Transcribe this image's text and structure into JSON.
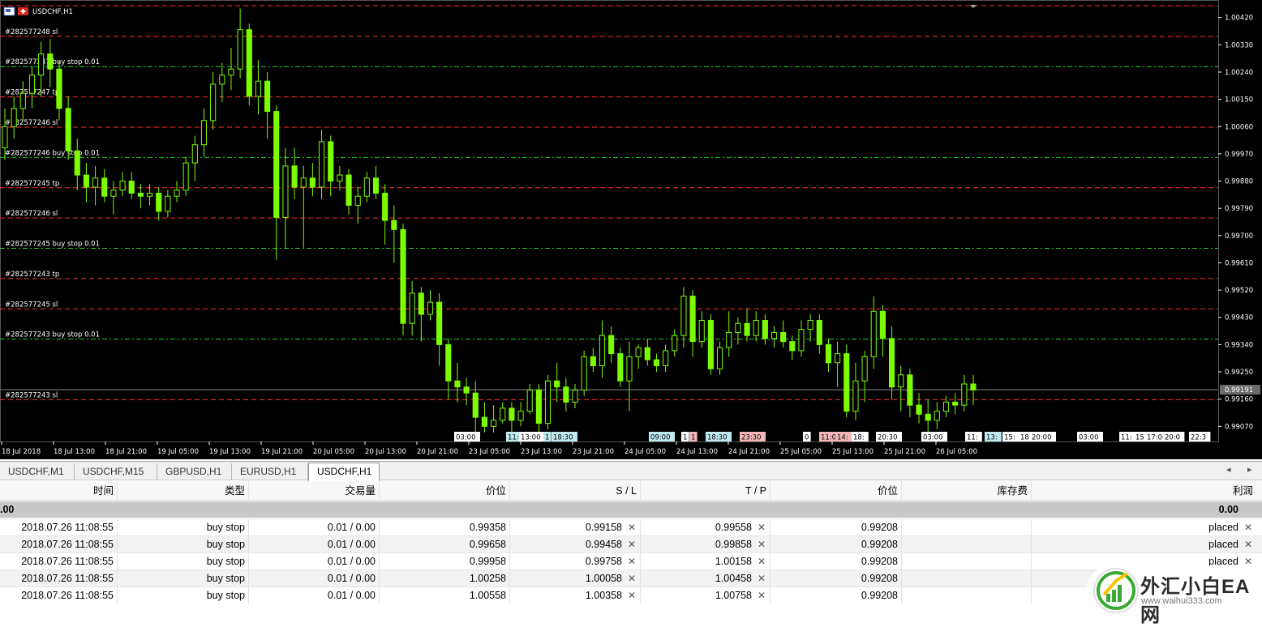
{
  "chart": {
    "title": "USDCHF,H1",
    "price_axis": [
      "1.00420",
      "1.00330",
      "1.00240",
      "1.00150",
      "1.00060",
      "0.99970",
      "0.99880",
      "0.99790",
      "0.99700",
      "0.99610",
      "0.99520",
      "0.99430",
      "0.99340",
      "0.99250",
      "0.99160",
      "0.99070"
    ],
    "current_price": "0.99191",
    "time_axis": [
      "18 Jul 2018",
      "18 Jul 13:00",
      "18 Jul 21:00",
      "19 Jul 05:00",
      "19 Jul 13:00",
      "19 Jul 21:00",
      "20 Jul 05:00",
      "20 Jul 13:00",
      "20 Jul 21:00",
      "23 Jul 05:00",
      "23 Jul 13:00",
      "23 Jul 21:00",
      "24 Jul 05:00",
      "24 Jul 13:00",
      "24 Jul 21:00",
      "25 Jul 05:00",
      "25 Jul 13:00",
      "25 Jul 21:00",
      "26 Jul 05:00"
    ],
    "order_lines": [
      {
        "label": "#282577248 sl",
        "type": "sl",
        "price": 1.00358
      },
      {
        "label": "#282577247 buy stop 0.01",
        "type": "entry",
        "price": 1.00258
      },
      {
        "label": "#282577247 tp",
        "type": "tp",
        "price": 1.00158
      },
      {
        "label": "#282577246 sl",
        "type": "sl",
        "price": 1.00058
      },
      {
        "label": "#282577246 buy stop 0.01",
        "type": "entry",
        "price": 0.99958
      },
      {
        "label": "#282577245 tp",
        "type": "tp",
        "price": 0.99858
      },
      {
        "label": "#282577246 sl",
        "type": "sl",
        "price": 0.99758
      },
      {
        "label": "#282577245 buy stop 0.01",
        "type": "entry",
        "price": 0.99658
      },
      {
        "label": "#282577243 tp",
        "type": "tp",
        "price": 0.99558
      },
      {
        "label": "#282577245 sl",
        "type": "sl",
        "price": 0.99458
      },
      {
        "label": "#282577243 buy stop 0.01",
        "type": "entry",
        "price": 0.99358
      },
      {
        "label": "#282577243 sl",
        "type": "sl",
        "price": 0.99158
      }
    ],
    "event_tags": [
      {
        "text": "03:00",
        "kind": "white"
      },
      {
        "text": "11:",
        "kind": "cyan"
      },
      {
        "text": "13:00",
        "kind": "white"
      },
      {
        "text": "1",
        "kind": "cyan"
      },
      {
        "text": "18:30",
        "kind": "cyan"
      },
      {
        "text": "09:00",
        "kind": "cyan"
      },
      {
        "text": "1",
        "kind": "white"
      },
      {
        "text": "1",
        "kind": "pink"
      },
      {
        "text": "18:30",
        "kind": "cyan"
      },
      {
        "text": "23:30",
        "kind": "pink"
      },
      {
        "text": "0",
        "kind": "white"
      },
      {
        "text": "11:00",
        "kind": "pink"
      },
      {
        "text": "14:",
        "kind": "pink"
      },
      {
        "text": "18:",
        "kind": "white"
      },
      {
        "text": "20:30",
        "kind": "white"
      },
      {
        "text": "03:00",
        "kind": "white"
      },
      {
        "text": "11:",
        "kind": "white"
      },
      {
        "text": "13:",
        "kind": "cyan"
      },
      {
        "text": "15:",
        "kind": "white"
      },
      {
        "text": "18:",
        "kind": "white"
      },
      {
        "text": "20:00",
        "kind": "white"
      },
      {
        "text": "03:00",
        "kind": "white"
      },
      {
        "text": "11:",
        "kind": "white"
      },
      {
        "text": "15",
        "kind": "white"
      },
      {
        "text": "17:00",
        "kind": "white"
      },
      {
        "text": "20:0",
        "kind": "white"
      },
      {
        "text": "22:3",
        "kind": "white"
      }
    ],
    "colors": {
      "bg": "#000000",
      "candle": "#7cfc00",
      "sl_line": "#ff3030",
      "entry_line": "#2ecc40",
      "axis": "#ffffff",
      "current_line": "#8c8c8c"
    }
  },
  "chart_data": {
    "type": "candlestick",
    "title": "USDCHF,H1",
    "ylim": [
      0.9902,
      1.0047
    ],
    "ohlc": [
      [
        0.9999,
        1.0012,
        0.9995,
        1.0006
      ],
      [
        1.0006,
        1.0016,
        1.0002,
        1.0012
      ],
      [
        1.0012,
        1.0021,
        1.0008,
        1.0017
      ],
      [
        1.0017,
        1.0026,
        1.0012,
        1.0023
      ],
      [
        1.0023,
        1.0034,
        1.0016,
        1.003
      ],
      [
        1.003,
        1.0035,
        1.0019,
        1.0025
      ],
      [
        1.0025,
        1.0028,
        1.0008,
        1.0012
      ],
      [
        1.0012,
        1.0016,
        0.9995,
        0.9998
      ],
      [
        0.9998,
        1.0002,
        0.9985,
        0.999
      ],
      [
        0.999,
        0.9994,
        0.9981,
        0.9986
      ],
      [
        0.9986,
        0.9993,
        0.998,
        0.9989
      ],
      [
        0.9989,
        0.9992,
        0.9981,
        0.9983
      ],
      [
        0.9983,
        0.9988,
        0.9977,
        0.9985
      ],
      [
        0.9985,
        0.9991,
        0.9983,
        0.9988
      ],
      [
        0.9988,
        0.9991,
        0.9982,
        0.9984
      ],
      [
        0.9984,
        0.9987,
        0.9979,
        0.9983
      ],
      [
        0.9983,
        0.9987,
        0.998,
        0.9984
      ],
      [
        0.9984,
        0.9986,
        0.9975,
        0.9978
      ],
      [
        0.9978,
        0.9985,
        0.9976,
        0.9983
      ],
      [
        0.9983,
        0.9988,
        0.9981,
        0.9985
      ],
      [
        0.9985,
        0.9996,
        0.9983,
        0.9994
      ],
      [
        0.9994,
        1.0003,
        0.9988,
        1.0
      ],
      [
        1.0,
        1.0012,
        0.9996,
        1.0008
      ],
      [
        1.0008,
        1.0024,
        1.0005,
        1.002
      ],
      [
        1.002,
        1.0027,
        1.0014,
        1.0023
      ],
      [
        1.0023,
        1.0032,
        1.0018,
        1.0025
      ],
      [
        1.0025,
        1.0045,
        1.0022,
        1.0038
      ],
      [
        1.0038,
        1.004,
        1.0013,
        1.0016
      ],
      [
        1.0016,
        1.0028,
        1.001,
        1.0021
      ],
      [
        1.0021,
        1.0024,
        1.0002,
        1.0011
      ],
      [
        1.0011,
        1.0013,
        0.9962,
        0.9976
      ],
      [
        0.9976,
        0.9999,
        0.9966,
        0.9993
      ],
      [
        0.9993,
        0.9999,
        0.9982,
        0.9986
      ],
      [
        0.9986,
        0.9993,
        0.9966,
        0.9989
      ],
      [
        0.9989,
        0.9994,
        0.9983,
        0.9986
      ],
      [
        0.9986,
        1.0005,
        0.9982,
        1.0001
      ],
      [
        1.0001,
        1.0003,
        0.9983,
        0.9988
      ],
      [
        0.9988,
        0.9993,
        0.9985,
        0.999
      ],
      [
        0.999,
        0.9992,
        0.9977,
        0.998
      ],
      [
        0.998,
        0.9986,
        0.9974,
        0.9983
      ],
      [
        0.9983,
        0.9991,
        0.9981,
        0.9989
      ],
      [
        0.9989,
        0.9993,
        0.9982,
        0.9984
      ],
      [
        0.9984,
        0.9987,
        0.9967,
        0.9975
      ],
      [
        0.9975,
        0.998,
        0.9961,
        0.9972
      ],
      [
        0.9972,
        0.9974,
        0.9937,
        0.9941
      ],
      [
        0.9941,
        0.9955,
        0.9937,
        0.9951
      ],
      [
        0.9951,
        0.9953,
        0.9935,
        0.9944
      ],
      [
        0.9944,
        0.9952,
        0.9942,
        0.9948
      ],
      [
        0.9948,
        0.9951,
        0.9927,
        0.9934
      ],
      [
        0.9934,
        0.9936,
        0.9916,
        0.9922
      ],
      [
        0.9922,
        0.9928,
        0.9915,
        0.992
      ],
      [
        0.992,
        0.9923,
        0.9914,
        0.9918
      ],
      [
        0.9918,
        0.9922,
        0.9905,
        0.991
      ],
      [
        0.991,
        0.9915,
        0.9905,
        0.9907
      ],
      [
        0.9907,
        0.9914,
        0.9905,
        0.9909
      ],
      [
        0.9909,
        0.9915,
        0.9908,
        0.9913
      ],
      [
        0.9913,
        0.9915,
        0.9905,
        0.9909
      ],
      [
        0.9909,
        0.9915,
        0.9907,
        0.9912
      ],
      [
        0.9912,
        0.9921,
        0.9911,
        0.9919
      ],
      [
        0.9919,
        0.9921,
        0.9905,
        0.9908
      ],
      [
        0.9908,
        0.9924,
        0.9906,
        0.9922
      ],
      [
        0.9922,
        0.9928,
        0.9915,
        0.992
      ],
      [
        0.992,
        0.9923,
        0.9912,
        0.9915
      ],
      [
        0.9915,
        0.9921,
        0.9913,
        0.9919
      ],
      [
        0.9919,
        0.9932,
        0.9917,
        0.993
      ],
      [
        0.993,
        0.9933,
        0.9925,
        0.9927
      ],
      [
        0.9927,
        0.9942,
        0.9923,
        0.9937
      ],
      [
        0.9937,
        0.994,
        0.9928,
        0.9931
      ],
      [
        0.9931,
        0.9933,
        0.992,
        0.9922
      ],
      [
        0.9922,
        0.9935,
        0.9912,
        0.993
      ],
      [
        0.993,
        0.9934,
        0.9926,
        0.9933
      ],
      [
        0.9933,
        0.9936,
        0.9927,
        0.9929
      ],
      [
        0.9929,
        0.9931,
        0.9925,
        0.9927
      ],
      [
        0.9927,
        0.9934,
        0.9925,
        0.9932
      ],
      [
        0.9932,
        0.9939,
        0.993,
        0.9937
      ],
      [
        0.9937,
        0.9953,
        0.9933,
        0.995
      ],
      [
        0.995,
        0.9952,
        0.993,
        0.9935
      ],
      [
        0.9935,
        0.9945,
        0.9933,
        0.9942
      ],
      [
        0.9942,
        0.9944,
        0.9924,
        0.9926
      ],
      [
        0.9926,
        0.9935,
        0.9924,
        0.9933
      ],
      [
        0.9933,
        0.9945,
        0.993,
        0.9938
      ],
      [
        0.9938,
        0.9943,
        0.9934,
        0.9941
      ],
      [
        0.9941,
        0.9946,
        0.9935,
        0.9937
      ],
      [
        0.9937,
        0.9945,
        0.9935,
        0.9942
      ],
      [
        0.9942,
        0.9944,
        0.9934,
        0.9936
      ],
      [
        0.9936,
        0.994,
        0.9933,
        0.9938
      ],
      [
        0.9938,
        0.9942,
        0.9933,
        0.9935
      ],
      [
        0.9935,
        0.9937,
        0.9929,
        0.9932
      ],
      [
        0.9932,
        0.9942,
        0.993,
        0.9939
      ],
      [
        0.9939,
        0.9944,
        0.9935,
        0.9942
      ],
      [
        0.9942,
        0.9944,
        0.9931,
        0.9934
      ],
      [
        0.9934,
        0.9936,
        0.9925,
        0.9928
      ],
      [
        0.9928,
        0.9935,
        0.992,
        0.9931
      ],
      [
        0.9931,
        0.9934,
        0.991,
        0.9912
      ],
      [
        0.9912,
        0.9928,
        0.9909,
        0.9922
      ],
      [
        0.9922,
        0.9932,
        0.9915,
        0.993
      ],
      [
        0.993,
        0.995,
        0.9926,
        0.9945
      ],
      [
        0.9945,
        0.9947,
        0.993,
        0.9936
      ],
      [
        0.9936,
        0.994,
        0.9916,
        0.992
      ],
      [
        0.992,
        0.9927,
        0.9912,
        0.9924
      ],
      [
        0.9924,
        0.9926,
        0.991,
        0.9914
      ],
      [
        0.9914,
        0.9918,
        0.9908,
        0.9911
      ],
      [
        0.9911,
        0.9916,
        0.9904,
        0.9909
      ],
      [
        0.9909,
        0.9915,
        0.9906,
        0.9912
      ],
      [
        0.9912,
        0.9917,
        0.991,
        0.9915
      ],
      [
        0.9915,
        0.9918,
        0.9911,
        0.9914
      ],
      [
        0.9914,
        0.9924,
        0.9912,
        0.9921
      ],
      [
        0.9921,
        0.9924,
        0.9914,
        0.9919
      ]
    ]
  },
  "tabs": [
    {
      "label": "USDCHF,M1",
      "active": false
    },
    {
      "label": "USDCHF,M15",
      "active": false
    },
    {
      "label": "GBPUSD,H1",
      "active": false
    },
    {
      "label": "EURUSD,H1",
      "active": false
    },
    {
      "label": "USDCHF,H1",
      "active": true
    }
  ],
  "tab_nav": {
    "prev": "◂",
    "next": "▸"
  },
  "terminal": {
    "headers": [
      "时间",
      "类型",
      "交易量",
      "价位",
      "S / L",
      "T / P",
      "价位",
      "库存费",
      "利润"
    ],
    "summary": {
      "left": ".00",
      "right": "0.00"
    },
    "remove_glyph": "✕",
    "rows": [
      [
        "2018.07.26 11:08:55",
        "buy stop",
        "0.01 / 0.00",
        "0.99358",
        "0.99158",
        "0.99558",
        "0.99208",
        "",
        "placed"
      ],
      [
        "2018.07.26 11:08:55",
        "buy stop",
        "0.01 / 0.00",
        "0.99658",
        "0.99458",
        "0.99858",
        "0.99208",
        "",
        "placed"
      ],
      [
        "2018.07.26 11:08:55",
        "buy stop",
        "0.01 / 0.00",
        "0.99958",
        "0.99758",
        "1.00158",
        "0.99208",
        "",
        "placed"
      ],
      [
        "2018.07.26 11:08:55",
        "buy stop",
        "0.01 / 0.00",
        "1.00258",
        "1.00058",
        "1.00458",
        "0.99208",
        "",
        ""
      ],
      [
        "2018.07.26 11:08:55",
        "buy stop",
        "0.01 / 0.00",
        "1.00558",
        "1.00358",
        "1.00758",
        "0.99208",
        "",
        ""
      ]
    ]
  },
  "watermark": {
    "name": "外汇小白EA网",
    "url": "www.waihui333.com",
    "colors": {
      "green": "#3aaa35",
      "yellow": "#f2c500"
    }
  }
}
